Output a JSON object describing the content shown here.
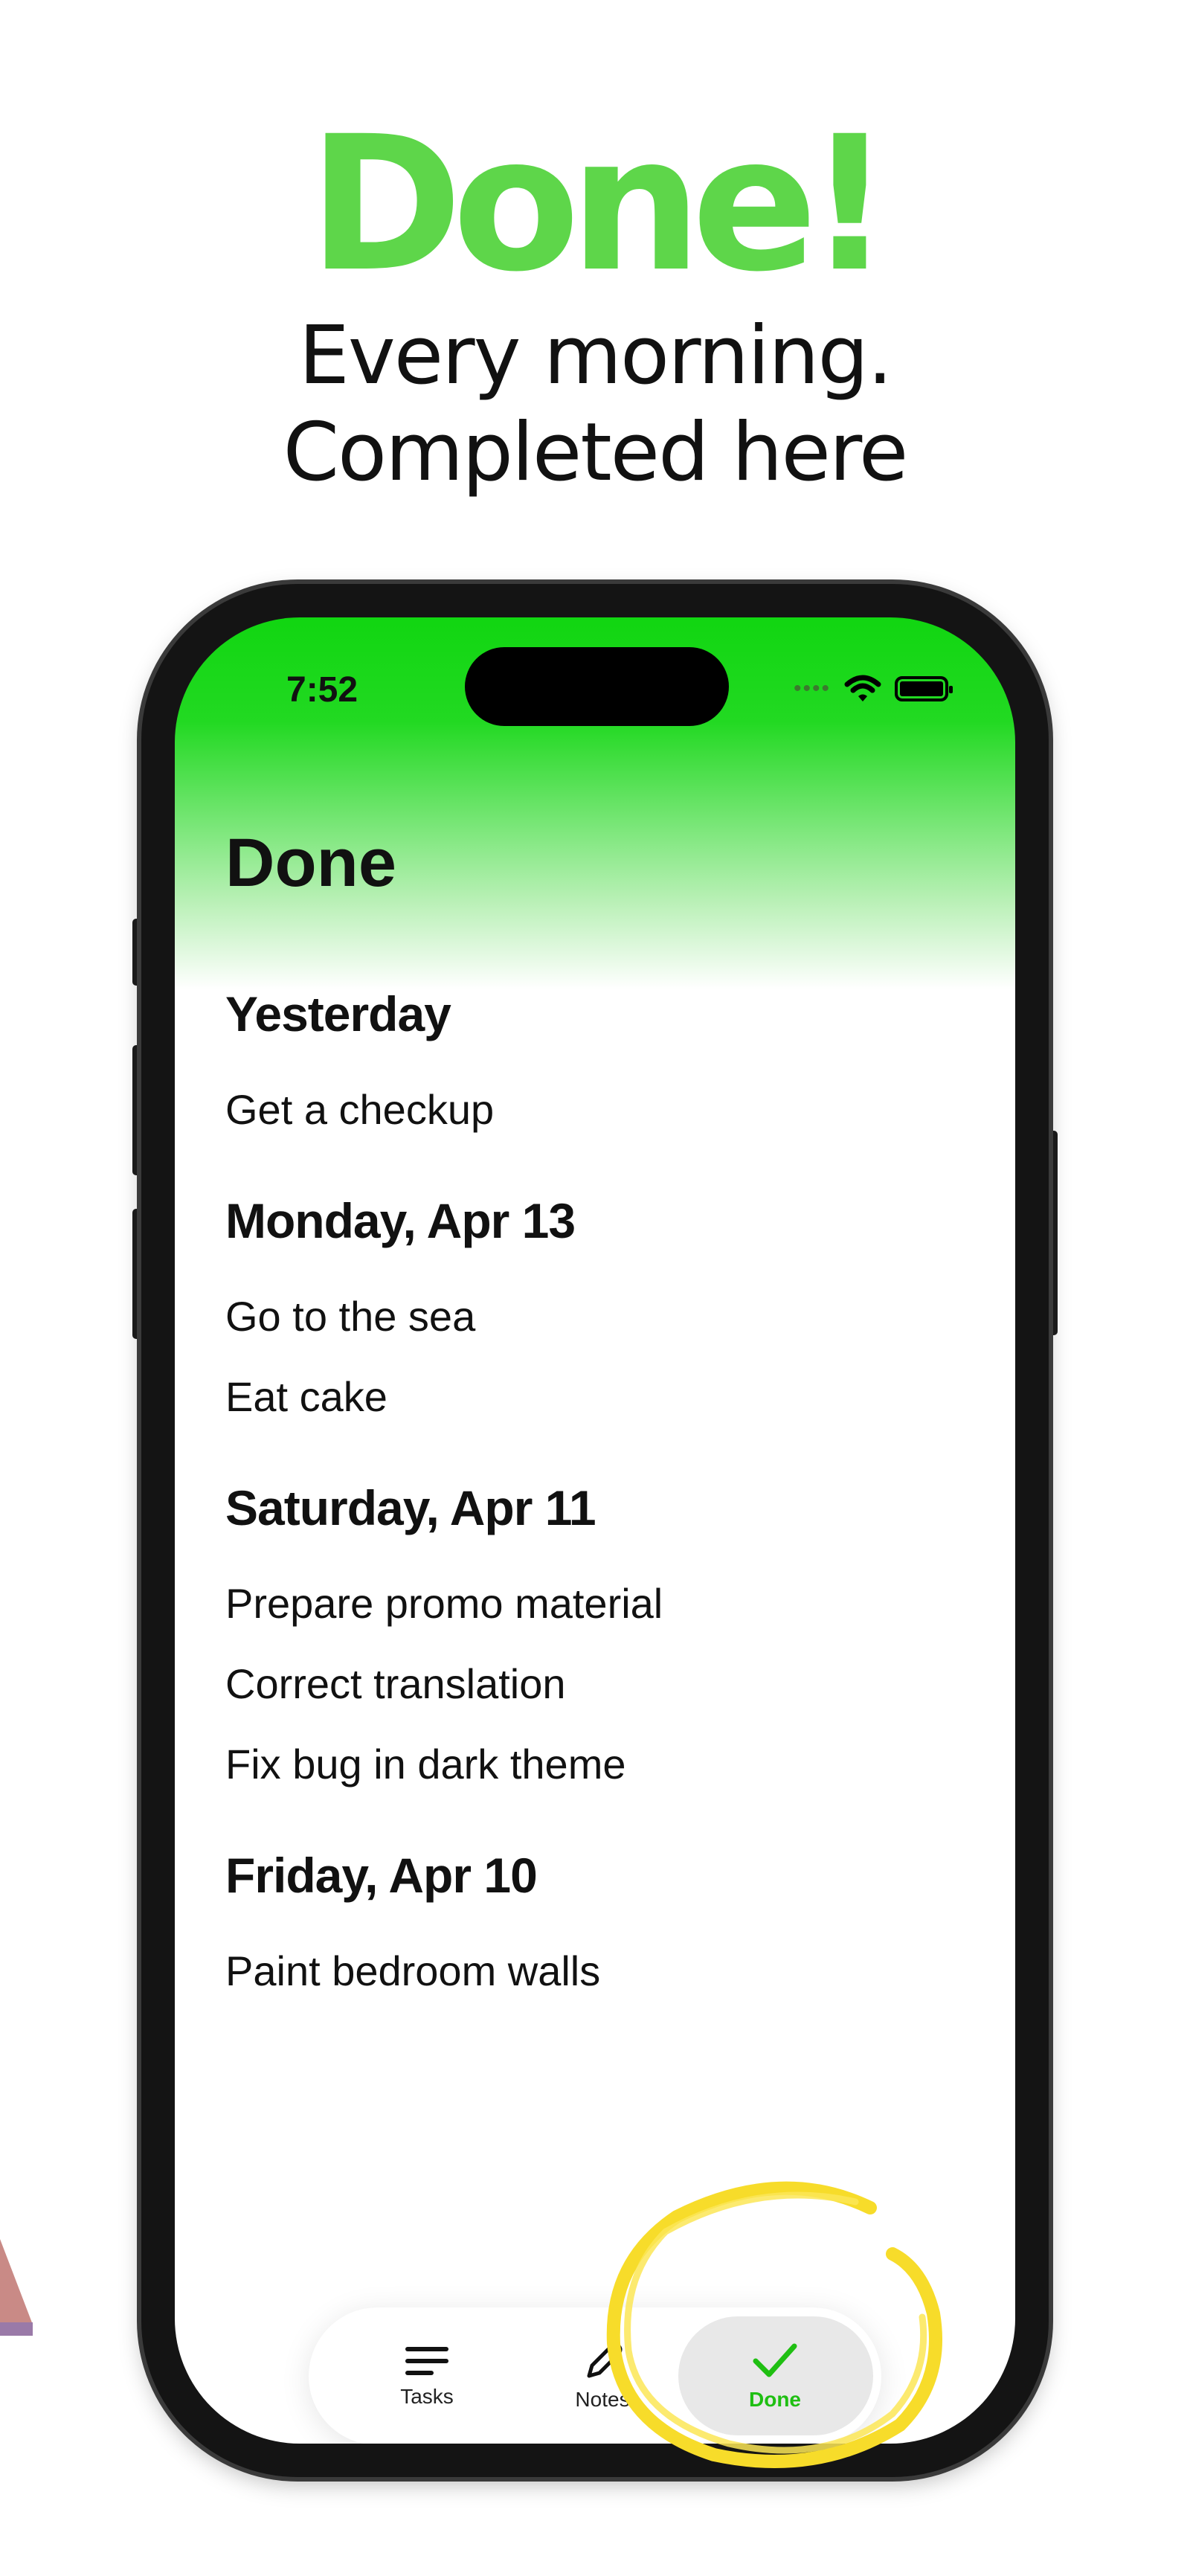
{
  "promo": {
    "headline": "Done!",
    "subline_1": "Every morning.",
    "subline_2": "Completed here",
    "headline_color": "#5ed64a"
  },
  "status_bar": {
    "time": "7:52",
    "signal_icon": "cellular-dots-icon",
    "wifi_icon": "wifi-icon",
    "battery_icon": "battery-icon"
  },
  "screen": {
    "title": "Done",
    "accent_color": "#11d611"
  },
  "sections": [
    {
      "heading": "Yesterday",
      "items": [
        "Get a checkup"
      ]
    },
    {
      "heading": "Monday, Apr 13",
      "items": [
        "Go to the sea",
        "Eat cake"
      ]
    },
    {
      "heading": "Saturday, Apr 11",
      "items": [
        "Prepare promo material",
        "Correct translation",
        "Fix bug in dark theme"
      ]
    },
    {
      "heading": "Friday, Apr 10",
      "items": [
        "Paint bedroom walls"
      ]
    }
  ],
  "tabbar": {
    "tasks_label": "Tasks",
    "notes_label": "Notes",
    "done_label": "Done",
    "active_tab": "Done",
    "active_color": "#1fbf12"
  }
}
